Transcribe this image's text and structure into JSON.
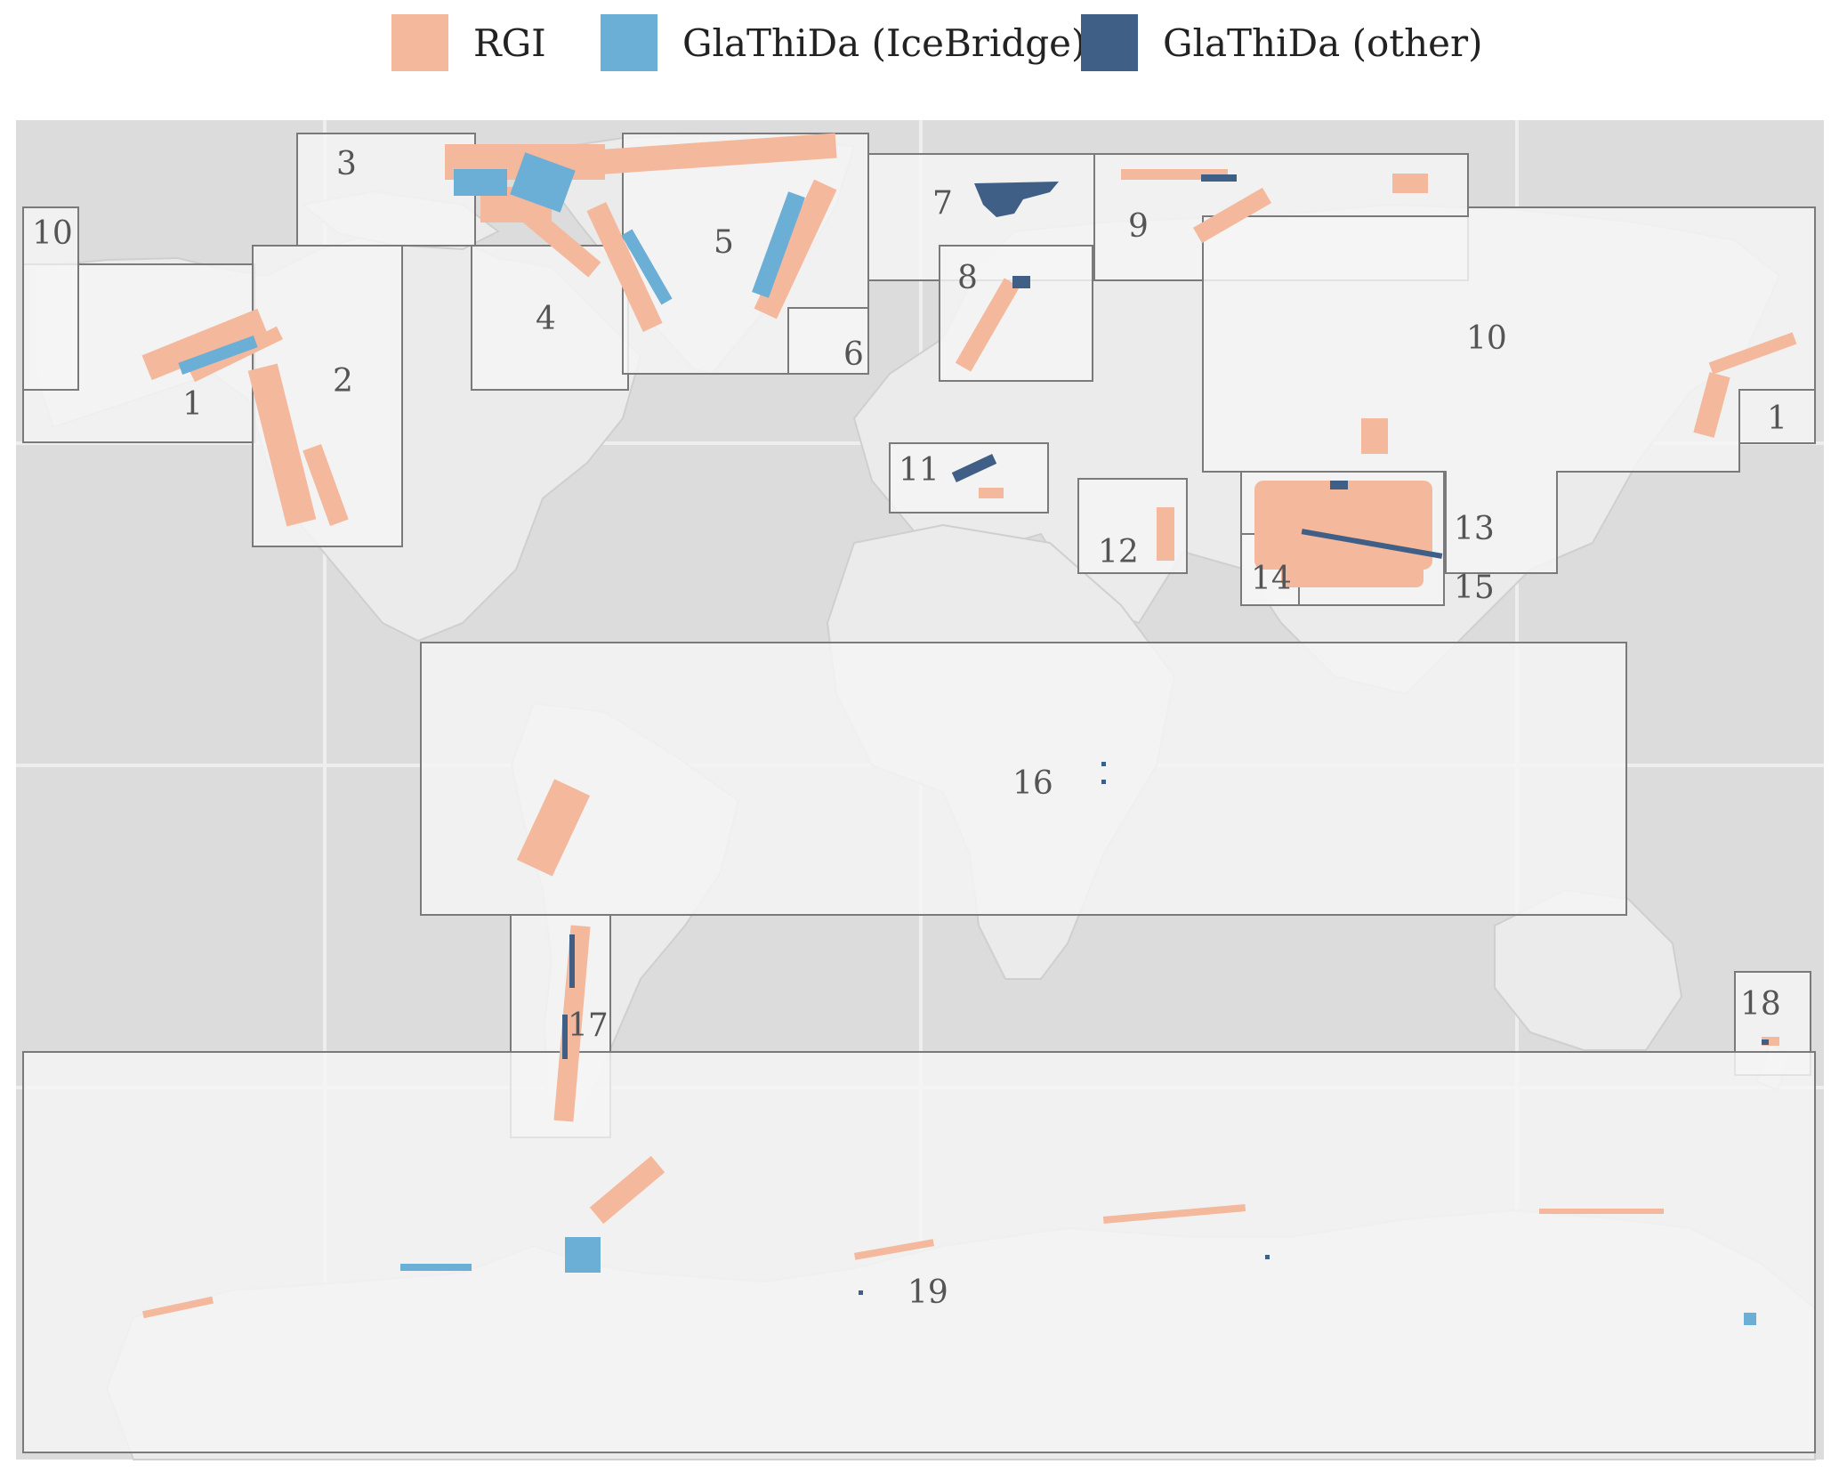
{
  "legend": {
    "items": [
      {
        "label": "RGI",
        "color": "#f4b89c"
      },
      {
        "label": "GlaThiDa (IceBridge)",
        "color": "#6baed6"
      },
      {
        "label": "GlaThiDa (other)",
        "color": "#3f5f87"
      }
    ]
  },
  "map": {
    "ocean_color": "#dcdcdc",
    "land_color": "#ebebeb",
    "region_fill": "#f5f5f5",
    "region_stroke": "#7a7a7a",
    "region_labels": [
      "1",
      "2",
      "3",
      "4",
      "5",
      "6",
      "7",
      "8",
      "9",
      "10",
      "10",
      "1",
      "11",
      "12",
      "13",
      "14",
      "15",
      "16",
      "17",
      "18",
      "19"
    ]
  }
}
